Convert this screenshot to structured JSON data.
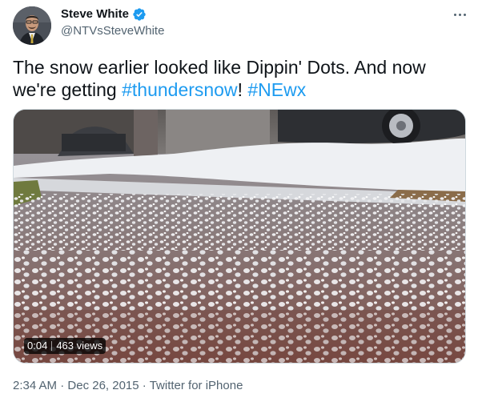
{
  "author": {
    "display_name": "Steve White",
    "handle": "@NTVsSteveWhite",
    "verified_icon": "verified-badge-icon",
    "avatar_icon": "avatar-photo"
  },
  "tweet": {
    "text_part1": "The snow earlier looked like Dippin' Dots. And now we're getting ",
    "hashtag1": "#thundersnow",
    "text_part2": "! ",
    "hashtag2": "#NEwx"
  },
  "media": {
    "duration": "0:04",
    "views": "463 views"
  },
  "meta": {
    "time": "2:34 AM",
    "dot1": " · ",
    "date": "Dec 26, 2015",
    "dot2": " · ",
    "source": "Twitter for iPhone"
  },
  "colors": {
    "link": "#1d9bf0",
    "secondary_text": "#536471",
    "primary_text": "#0f1419"
  },
  "more_icon": "more-options-icon"
}
